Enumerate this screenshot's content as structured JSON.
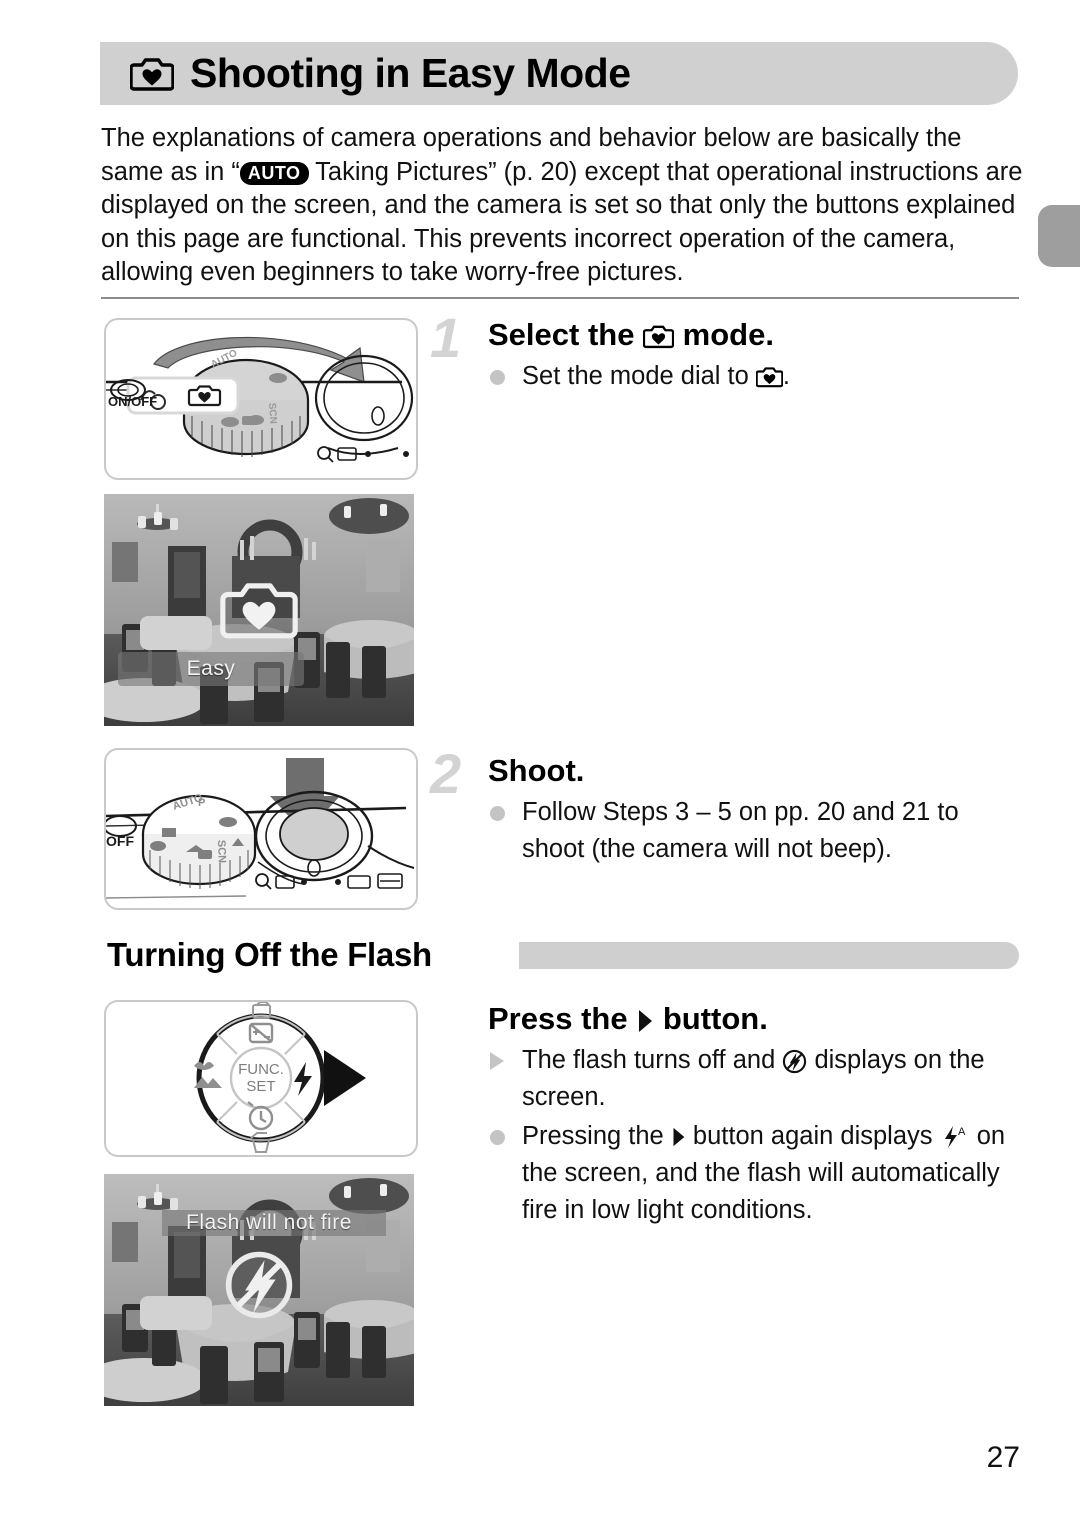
{
  "page": {
    "number": "27",
    "edge_tab_color": "#9e9e9e"
  },
  "title": {
    "icon": "camera-easy-mode-icon",
    "text": "Shooting in Easy Mode",
    "bar_color": "#d0d0d0"
  },
  "intro": {
    "part1": "The explanations of camera operations and behavior below are basically the same as in “",
    "badge": "AUTO",
    "part2": " Taking Pictures” (p. 20) except that operational instructions are displayed on the screen, and the camera is set so that only the buttons explained on this page are functional. This prevents incorrect operation of the camera, allowing even beginners to take worry-free pictures."
  },
  "steps": [
    {
      "number": "1",
      "heading_before": "Select the ",
      "heading_icon": "camera-easy-mode-icon",
      "heading_after": " mode.",
      "bullets": [
        {
          "marker": "dot",
          "before": "Set the mode dial to ",
          "icon": "camera-easy-mode-icon",
          "after": "."
        }
      ],
      "figure": "mode-dial-illustration"
    },
    {
      "number": "2",
      "heading_before": "Shoot.",
      "heading_icon": "",
      "heading_after": "",
      "bullets": [
        {
          "marker": "dot",
          "before": "Follow Steps 3 – 5 on pp. 20 and 21 to shoot (the camera will not beep).",
          "icon": "",
          "after": ""
        }
      ],
      "figure": "shutter-button-illustration"
    }
  ],
  "photos": {
    "easy_mode_screen": {
      "label": "Easy",
      "center_icon": "camera-heart-overlay-icon",
      "caption_position": "bottom"
    },
    "flash_off_screen": {
      "label": "Flash will not fire",
      "center_icon": "flash-off-overlay-icon",
      "caption_position": "top"
    }
  },
  "subsection": {
    "heading": "Turning Off the Flash",
    "bar_color": "#cfcfcf",
    "instruction": {
      "before": "Press the ",
      "icon": "right-arrow-button-icon",
      "after": " button."
    },
    "bullets": [
      {
        "marker": "triangle",
        "segments": [
          {
            "text": "The flash turns off and "
          },
          {
            "icon": "flash-off-icon"
          },
          {
            "text": " displays on the screen."
          }
        ]
      },
      {
        "marker": "dot",
        "segments": [
          {
            "text": "Pressing the "
          },
          {
            "icon": "right-arrow-button-icon"
          },
          {
            "text": " button again displays "
          },
          {
            "icon": "flash-auto-icon"
          },
          {
            "text": " on the screen, and the flash will automatically fire in low light conditions."
          }
        ]
      }
    ],
    "figure": "control-pad-flash-button-illustration"
  },
  "illustrations": {
    "mode_dial": {
      "name": "mode-dial-illustration",
      "labels": [
        "ON/OFF",
        "SCN"
      ]
    },
    "shutter_button": {
      "name": "shutter-button-illustration",
      "labels": [
        "OFF",
        "SCN",
        "AUTO",
        "P"
      ]
    },
    "control_pad": {
      "name": "control-pad-illustration",
      "center_label_line1": "FUNC.",
      "center_label_line2": "SET"
    }
  }
}
